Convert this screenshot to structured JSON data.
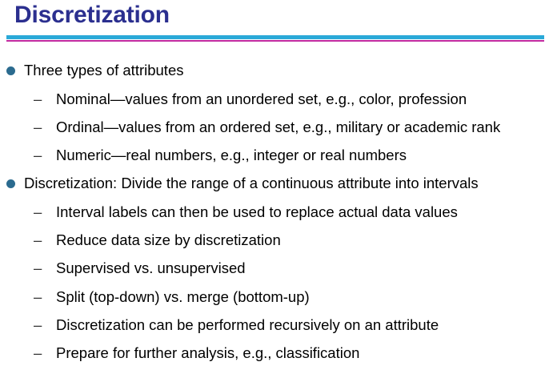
{
  "slide": {
    "title": "Discretization",
    "colors": {
      "title": "#2b2f8f",
      "rule_primary": "#2aa9d8",
      "rule_secondary": "#c02aa0",
      "bullet": "#2b6b8f"
    },
    "bullet_icon": "filled-circle",
    "sub_bullet_glyph": "–",
    "items": [
      {
        "text": "Three types of attributes",
        "sub": [
          "Nominal—values from an unordered set, e.g., color, profession",
          "Ordinal—values from an ordered set, e.g., military or academic rank",
          "Numeric—real numbers, e.g., integer or real numbers"
        ]
      },
      {
        "text": "Discretization: Divide the range of a continuous attribute into intervals",
        "sub": [
          "Interval labels can then be used to replace actual data values",
          "Reduce data size by discretization",
          "Supervised vs. unsupervised",
          "Split (top-down) vs. merge (bottom-up)",
          "Discretization can be performed recursively on an attribute",
          "Prepare for further analysis, e.g., classification"
        ]
      }
    ]
  }
}
